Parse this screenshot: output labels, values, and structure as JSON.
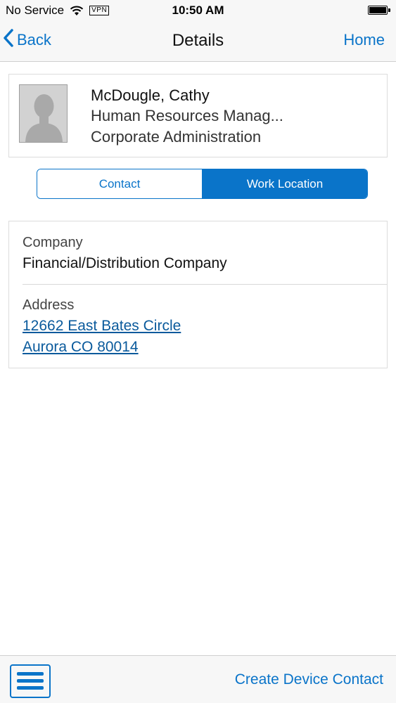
{
  "status_bar": {
    "carrier": "No Service",
    "vpn": "VPN",
    "time": "10:50 AM"
  },
  "nav": {
    "back_label": "Back",
    "title": "Details",
    "home_label": "Home"
  },
  "profile": {
    "name": "McDougle, Cathy",
    "job_title": "Human Resources Manag...",
    "department": "Corporate Administration"
  },
  "tabs": [
    {
      "label": "Contact",
      "active": false
    },
    {
      "label": "Work Location",
      "active": true
    }
  ],
  "work_location": {
    "company_label": "Company",
    "company_value": "Financial/Distribution Company",
    "address_label": "Address",
    "address_line1": "12662 East Bates Circle",
    "address_line2": "Aurora CO 80014"
  },
  "toolbar": {
    "menu_icon": "hamburger-menu-icon",
    "action_label": "Create Device Contact"
  },
  "colors": {
    "accent": "#0a74c9",
    "link": "#0a5a9c",
    "bar_background": "#f7f7f7"
  }
}
